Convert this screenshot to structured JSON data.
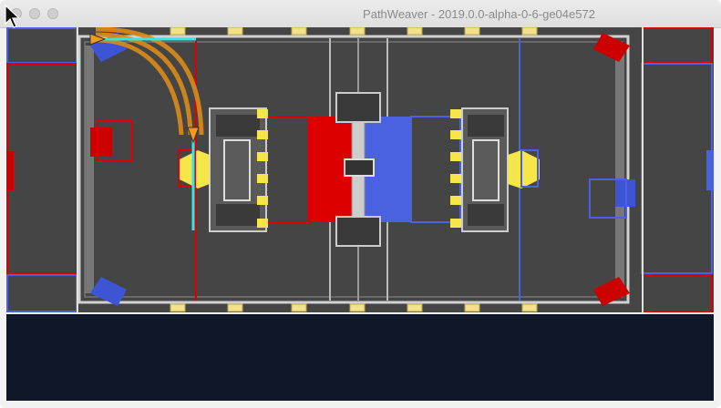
{
  "window": {
    "title": "PathWeaver - 2019.0.0-alpha-0-6-ge04e572"
  },
  "colors": {
    "red_alliance": "#dd0000",
    "blue_alliance": "#4b62e0",
    "path": "#d98a1a",
    "waypoint_tangent": "#33e6e6",
    "carpet": "#454545",
    "panel": "#0f1828"
  },
  "icons": [
    "close-button-icon",
    "minimize-button-icon",
    "zoom-button-icon",
    "mouse-pointer-icon",
    "waypoint-start-icon",
    "waypoint-end-icon"
  ]
}
